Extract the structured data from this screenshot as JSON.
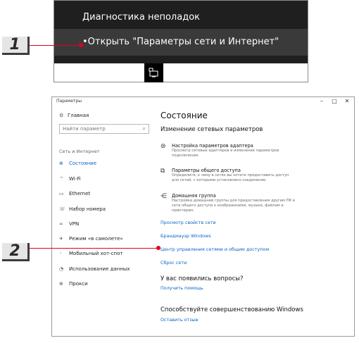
{
  "context_menu": {
    "item_troubleshoot": "Диагностика неполадок",
    "item_open_settings": "Открыть \"Параметры сети и Интернет\""
  },
  "callouts": {
    "one": "1",
    "two": "2"
  },
  "window": {
    "title": "Параметры",
    "controls": {
      "minimize": "–",
      "maximize": "□",
      "close": "✕"
    }
  },
  "sidebar": {
    "home": {
      "label": "Главная",
      "icon": "gear-icon"
    },
    "search_placeholder": "Найти параметр",
    "section": "Сеть и Интернет",
    "items": [
      {
        "label": "Состояние",
        "icon": "status-icon",
        "active": true
      },
      {
        "label": "Wi-Fi",
        "icon": "wifi-icon"
      },
      {
        "label": "Ethernet",
        "icon": "ethernet-icon"
      },
      {
        "label": "Набор номера",
        "icon": "dialup-icon"
      },
      {
        "label": "VPN",
        "icon": "vpn-icon"
      },
      {
        "label": "Режим «в самолете»",
        "icon": "airplane-icon"
      },
      {
        "label": "Мобильный хот-спот",
        "icon": "hotspot-icon"
      },
      {
        "label": "Использование данных",
        "icon": "data-usage-icon"
      },
      {
        "label": "Прокси",
        "icon": "proxy-icon"
      }
    ]
  },
  "main": {
    "title": "Состояние",
    "change_heading": "Изменение сетевых параметров",
    "options": [
      {
        "title": "Настройка параметров адаптера",
        "desc": "Просмотр сетевых адаптеров и изменение параметров подключения.",
        "icon": "adapter-icon"
      },
      {
        "title": "Параметры общего доступа",
        "desc": "Определите, к чему в сетях вы хотите предоставить доступ для сетей, с которыми установлено соединение.",
        "icon": "sharing-icon"
      },
      {
        "title": "Домашняя группа",
        "desc": "Настройка домашней группы для предоставления другим ПК в сети общего доступа к изображениям, музыке, файлам и принтерам.",
        "icon": "homegroup-icon"
      }
    ],
    "links": {
      "properties": "Просмотр свойств сети",
      "firewall": "Брандмауэр Windows",
      "network_center": "Центр управления сетями и общим доступом",
      "reset": "Сброс сети"
    },
    "questions_heading": "У вас появились вопросы?",
    "get_help": "Получить помощь",
    "improve_heading": "Способствуйте совершенствованию Windows",
    "feedback": "Оставить отзыв"
  },
  "colors": {
    "accent": "#0a64c8",
    "callout_line": "#e2001a",
    "menu_bg": "#1f1f1f",
    "menu_highlight": "#3a3a3a"
  }
}
